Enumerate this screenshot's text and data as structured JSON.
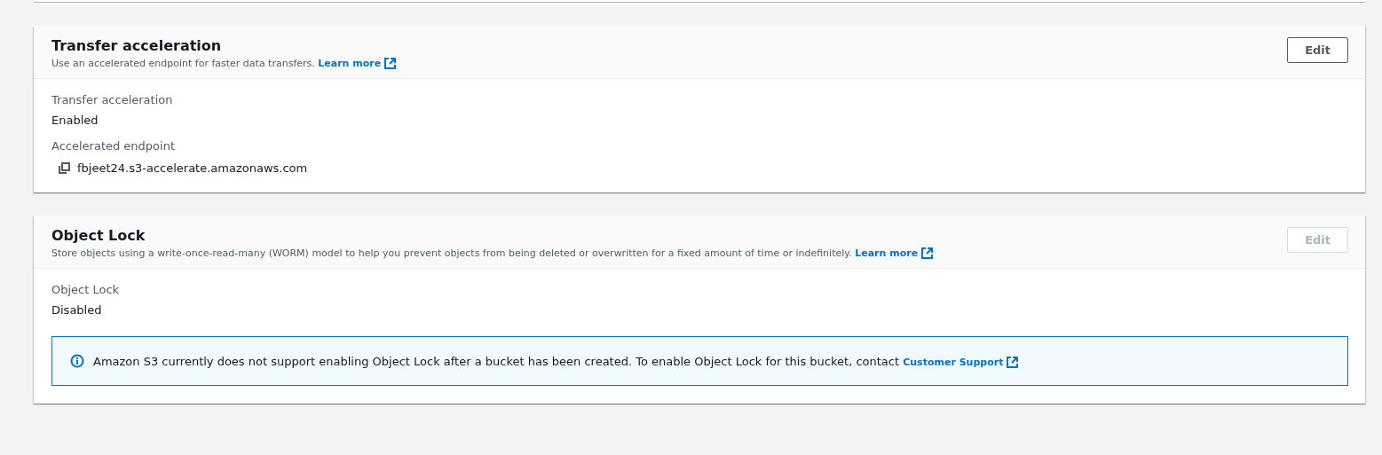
{
  "sections": [
    {
      "title": "Transfer acceleration",
      "description": "Use an accelerated endpoint for faster data transfers.",
      "link": "Learn more",
      "edit": {
        "label": "Edit",
        "disabled": false
      },
      "fields": [
        {
          "kind": "text",
          "label": "Transfer acceleration",
          "value": "Enabled"
        },
        {
          "kind": "copy",
          "label": "Accelerated endpoint",
          "value": "fbjeet24.s3-accelerate.amazonaws.com"
        }
      ]
    },
    {
      "title": "Object Lock",
      "description": "Store objects using a write-once-read-many (WORM) model to help you prevent objects from being deleted or overwritten for a fixed amount of time or indefinitely.",
      "link": "Learn more",
      "edit": {
        "label": "Edit",
        "disabled": true
      },
      "fields": [
        {
          "kind": "text",
          "label": "Object Lock",
          "value": "Disabled"
        }
      ],
      "alert": {
        "text": "Amazon S3 currently does not support enabling Object Lock after a bucket has been created. To enable Object Lock for this bucket, contact",
        "link": "Customer Support"
      }
    }
  ]
}
